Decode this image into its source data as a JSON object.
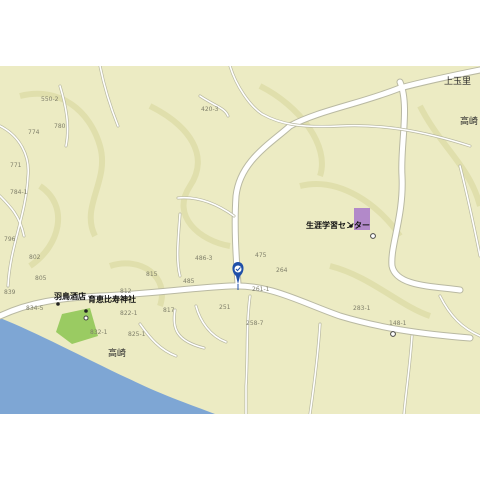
{
  "colors": {
    "land": "#ecebc3",
    "contour": "#e0dfac",
    "road": "#ffffff",
    "road_edge": "#b9b9a2",
    "sea": "#7ea6d4",
    "park": "#9acb62",
    "building": "#b289c9",
    "pin": "#1f4fa8"
  },
  "place_labels": {
    "kamitamari": "上玉里",
    "takasaki_ne": "高崎",
    "takasaki_sw": "高崎"
  },
  "poi_labels": {
    "lifelong_learning_center": "生涯学習センター",
    "hatori_liquor": "羽鳥酒店",
    "ebisu_shrine": "育恵比寿神社"
  },
  "parcel_numbers": [
    "550-2",
    "774",
    "780",
    "771",
    "420-3",
    "784-1",
    "796",
    "802",
    "805",
    "839",
    "834-5",
    "812",
    "822-1",
    "832-1",
    "825-1",
    "815",
    "817",
    "486-3",
    "485",
    "475",
    "264",
    "261-1",
    "251",
    "258-7",
    "283-1",
    "148-1"
  ],
  "marker": {
    "icon": "map-pin-icon"
  }
}
